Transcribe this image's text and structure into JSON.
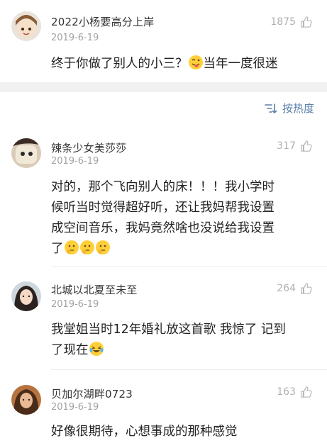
{
  "comments": [
    {
      "username": "2022小杨要高分上岸",
      "date": "2019-6-19",
      "likes": "1875",
      "text_before": "终于你做了别人的小三？",
      "emoji": "tongue-face",
      "text_after": "当年一度很迷"
    },
    {
      "username": "辣条少女美莎莎",
      "date": "2019-6-19",
      "likes": "317",
      "line1": "对的，那个飞向别人的床！！！我小学时",
      "line2": "候听当时觉得超好听，还让我妈帮我设置",
      "line3": "成空间音乐，我妈竟然啥也没说给我设置",
      "line4": "了",
      "emoji": "thinking-face"
    },
    {
      "username": "北城以北夏至未至",
      "date": "2019-6-19",
      "likes": "264",
      "line1": "我堂姐当时12年婚礼放这首歌 我惊了 记到",
      "line2": "了现在",
      "emoji": "laughing-tears-face"
    },
    {
      "username": "贝加尔湖畔0723",
      "date": "2019-6-19",
      "likes": "163",
      "text": "好像很期待，心想事成的那种感觉"
    }
  ],
  "sort": {
    "label": "按热度",
    "icon": "sort-icon"
  },
  "colors": {
    "link": "#5b7fa8",
    "muted": "#a3a3a3",
    "band": "#f1f1f1"
  }
}
